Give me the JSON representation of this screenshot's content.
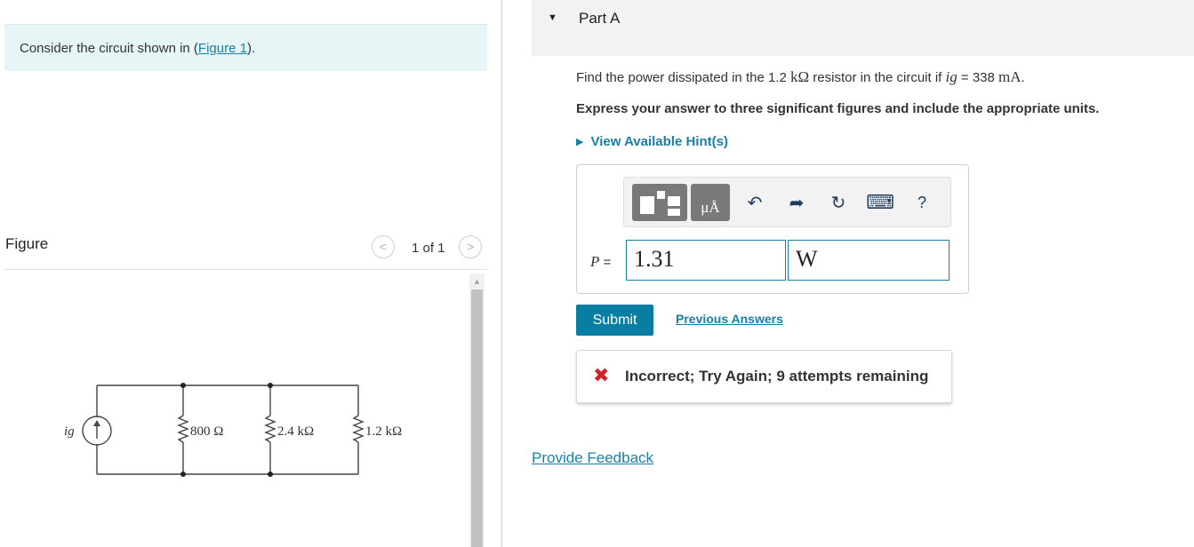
{
  "intro": {
    "text": "Consider the circuit shown in (",
    "link": "Figure 1",
    "suffix": ")."
  },
  "figure": {
    "label": "Figure",
    "page_count": "1 of 1",
    "prev_glyph": "<",
    "next_glyph": ">",
    "circuit": {
      "source_label": "ig",
      "r1": "800 Ω",
      "r2": "2.4 kΩ",
      "r3": "1.2 kΩ"
    }
  },
  "part": {
    "title": "Part A",
    "question_pre": "Find the power dissipated in the 1.2 ",
    "question_unit": "kΩ",
    "question_mid": " resistor in the circuit if ",
    "question_var": "ig",
    "question_eq": " = 338 ",
    "question_val_unit": "mA",
    "question_end": ".",
    "instruction": "Express your answer to three significant figures and include the appropriate units.",
    "hint": "View Available Hint(s)"
  },
  "answer": {
    "label_var": "P",
    "label_eq": " =",
    "value": "1.31",
    "unit": "W",
    "toolbar": {
      "mu_label": "μÅ",
      "undo_glyph": "↶",
      "redo_glyph": "➦",
      "reset_glyph": "↻",
      "keyboard_glyph": "⌨",
      "help_glyph": "?"
    }
  },
  "actions": {
    "submit": "Submit",
    "previous": "Previous Answers"
  },
  "feedback": {
    "icon": "✖",
    "message": "Incorrect; Try Again; 9 attempts remaining"
  },
  "footer": {
    "provide_feedback": "Provide Feedback"
  }
}
